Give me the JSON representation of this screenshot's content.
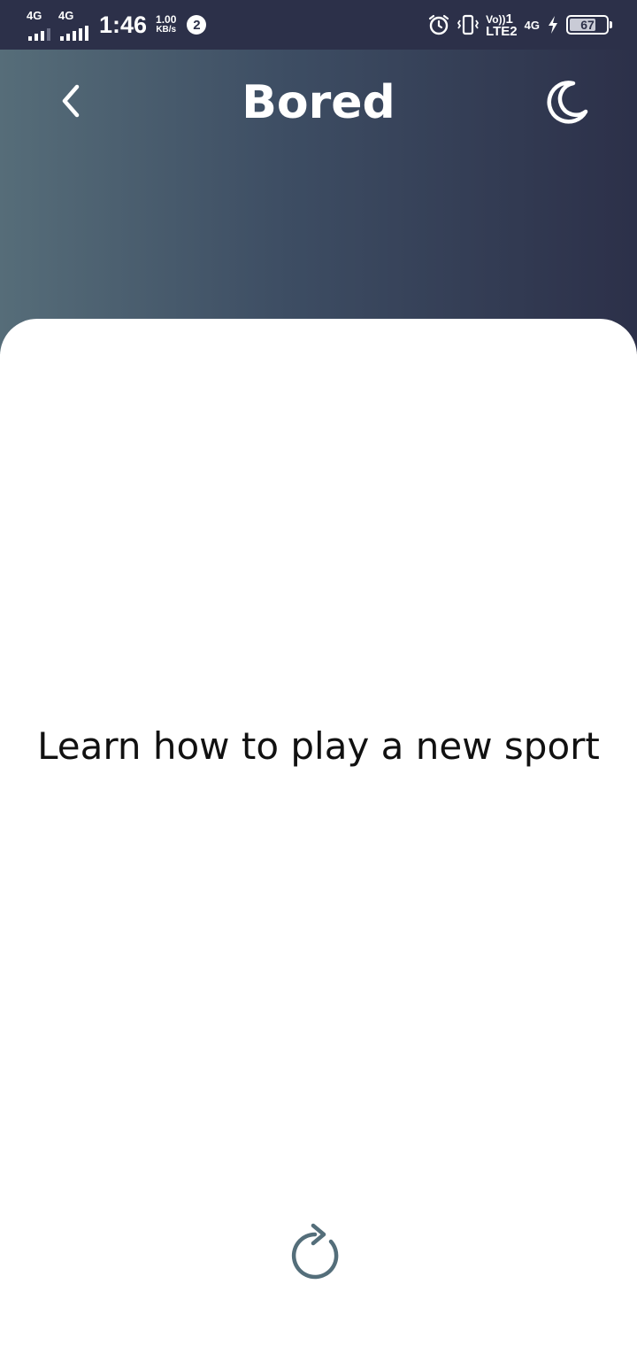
{
  "status_bar": {
    "sim1_network": "4G",
    "sim2_network": "4G",
    "time": "1:46",
    "speed_value": "1.00",
    "speed_unit": "KB/s",
    "notification_count": "2",
    "volte_top": "Vo))",
    "volte_sim": "1",
    "volte_bottom": "LTE2",
    "network_type": "4G",
    "battery_level": "67",
    "icons": [
      "alarm-icon",
      "vibrate-icon",
      "charging-icon"
    ]
  },
  "header": {
    "title": "Bored",
    "back_icon": "chevron-left-icon",
    "theme_icon": "moon-icon",
    "gradient_colors": [
      "#566d79",
      "#2c3049"
    ]
  },
  "main": {
    "activity": "Learn how to play a new sport",
    "refresh_icon": "refresh-icon",
    "accent_color": "#546e7a"
  }
}
